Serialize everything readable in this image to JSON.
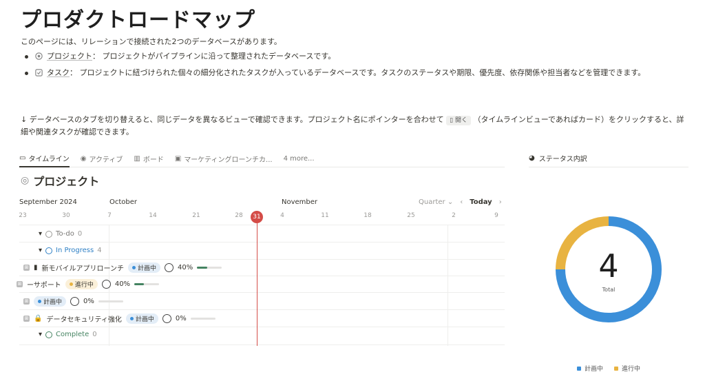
{
  "page": {
    "title": "プロダクトロードマップ",
    "intro": "このページには、リレーションで接続された2つのデータベースがあります。",
    "bullets": [
      {
        "link": "プロジェクト",
        "text": "： プロジェクトがパイプラインに沿って整理されたデータベースです。"
      },
      {
        "link": "タスク",
        "text": "： プロジェクトに紐づけられた個々の細分化されたタスクが入っているデータベースです。タスクのステータスや期限、優先度、依存関係や担当者などを管理できます。"
      }
    ],
    "note_before": "↓ データベースのタブを切り替えると、同じデータを異なるビューで確認できます。プロジェクト名にポインターを合わせて",
    "note_kbd": "開く",
    "note_after": "（タイムラインビューであればカード）をクリックすると、詳細や関連タスクが確認できます。"
  },
  "tabs": [
    "タイムライン",
    "アクティブ",
    "ボード",
    "マーケティングローンチカ...",
    "4 more..."
  ],
  "side_tab": "ステータス内訳",
  "db_title": "プロジェクト",
  "timeline": {
    "months": [
      "September 2024",
      "October",
      "November"
    ],
    "days": [
      "23",
      "30",
      "7",
      "14",
      "21",
      "28",
      "31",
      "4",
      "11",
      "18",
      "25",
      "2",
      "9"
    ],
    "today_day": "31",
    "quarter_label": "Quarter",
    "today_label": "Today",
    "groups": [
      {
        "name": "To-do",
        "count": "0",
        "color": "#787774"
      },
      {
        "name": "In Progress",
        "count": "4",
        "color": "#2f80c5"
      },
      {
        "name": "Complete",
        "count": "0",
        "color": "#448361"
      }
    ],
    "rows": [
      {
        "name": "新モバイルアプリローンチ",
        "status": "計画中",
        "status_type": "plan",
        "progress_text": "40%",
        "progress": 0.4
      },
      {
        "name": "ーサポート",
        "status": "進行中",
        "status_type": "prog",
        "progress_text": "40%",
        "progress": 0.4
      },
      {
        "name": "",
        "status": "計画中",
        "status_type": "plan",
        "progress_text": "0%",
        "progress": 0
      },
      {
        "name": "データセキュリティ強化",
        "status": "計画中",
        "status_type": "plan",
        "progress_text": "0%",
        "progress": 0
      }
    ]
  },
  "chart_data": {
    "type": "pie",
    "categories": [
      "計画中",
      "進行中"
    ],
    "values": [
      3,
      1
    ],
    "colors": [
      "#3b8fd9",
      "#e8b341"
    ],
    "center_value": "4",
    "center_label": "Total",
    "legend": "bottom"
  }
}
